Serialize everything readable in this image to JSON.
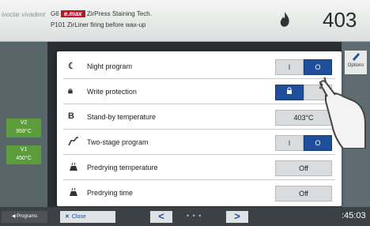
{
  "header": {
    "logo_text": "ivoclar vivadent",
    "line1_prefix": "G6",
    "brand": "e.max",
    "line1_suffix": "ZirPress Staining Tech.",
    "line2": "P101 ZirLiner firing before wax-up",
    "temperature": "403"
  },
  "left_sidebar": {
    "v2_label": "V2",
    "v2_value": "959°C",
    "v1_label": "V1",
    "v1_value": "450°C"
  },
  "options_label": "Options",
  "rows": [
    {
      "label": "Night program",
      "icon": "moon-icon"
    },
    {
      "label": "Write protection",
      "icon": "lock-icon"
    },
    {
      "label": "Stand-by temperature",
      "icon": "letter-b-icon",
      "value": "403°C"
    },
    {
      "label": "Two-stage program",
      "icon": "two-stage-icon"
    },
    {
      "label": "Predrying temperature",
      "icon": "predrying-icon",
      "value": "Off"
    },
    {
      "label": "Predrying time",
      "icon": "predrying-time-icon",
      "value": "Off"
    }
  ],
  "toggle": {
    "on_label": "I",
    "off_label": "O"
  },
  "bottom": {
    "programs_label": "Programs",
    "close_label": "Close",
    "prev": "<",
    "next": ">",
    "dots": "• • •",
    "clock": ":45:03"
  },
  "colors": {
    "accent_blue": "#1f4f9a",
    "brand_red": "#c0142a",
    "badge_green": "#5c9c3a"
  }
}
